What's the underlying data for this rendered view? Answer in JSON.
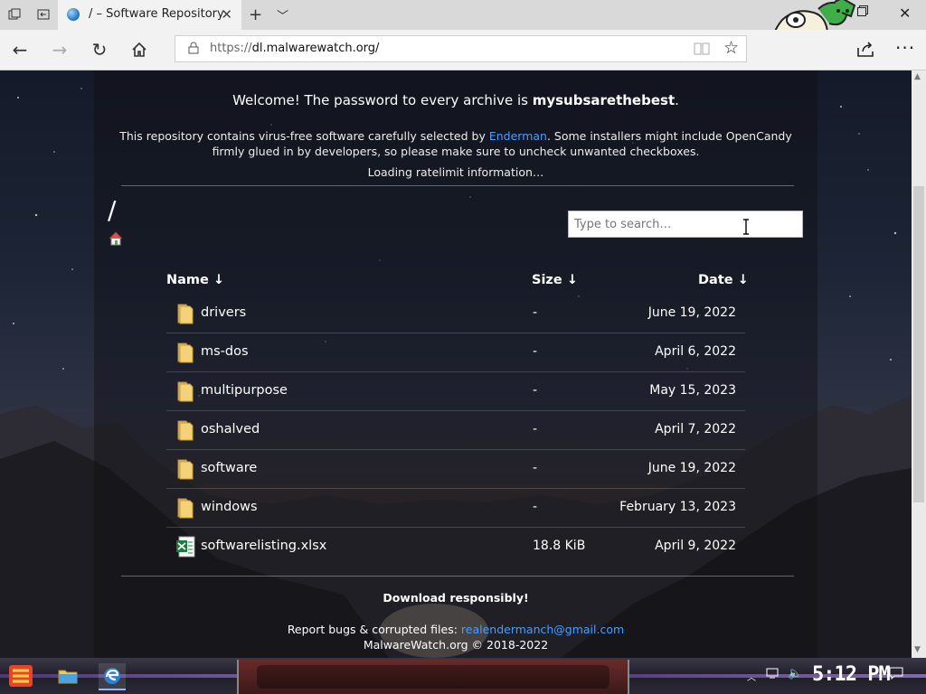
{
  "browser": {
    "tab_title": "/ – Software Repository",
    "url_protocol": "https://",
    "url_host": "dl.malwarewatch.org",
    "url_path": "/"
  },
  "page": {
    "welcome_text": "Welcome! The password to every archive is ",
    "password": "mysubsarethebest",
    "welcome_end": ".",
    "desc_part1": "This repository contains virus-free software carefully selected by ",
    "desc_link": "Enderman",
    "desc_part2": ". Some installers might include OpenCandy firmly glued in by developers, so please make sure to uncheck unwanted checkboxes.",
    "ratelimit": "Loading ratelimit information…",
    "path": "/",
    "search_placeholder": "Type to search…",
    "columns": {
      "name": "Name ↓",
      "size": "Size ↓",
      "date": "Date ↓"
    },
    "files": [
      {
        "name": "drivers",
        "size": "-",
        "date": "June 19, 2022",
        "type": "folder"
      },
      {
        "name": "ms-dos",
        "size": "-",
        "date": "April 6, 2022",
        "type": "folder"
      },
      {
        "name": "multipurpose",
        "size": "-",
        "date": "May 15, 2023",
        "type": "folder"
      },
      {
        "name": "oshalved",
        "size": "-",
        "date": "April 7, 2022",
        "type": "folder"
      },
      {
        "name": "software",
        "size": "-",
        "date": "June 19, 2022",
        "type": "folder"
      },
      {
        "name": "windows",
        "size": "-",
        "date": "February 13, 2023",
        "type": "folder"
      },
      {
        "name": "softwarelisting.xlsx",
        "size": "18.8 KiB",
        "date": "April 9, 2022",
        "type": "excel"
      }
    ],
    "footer_bold": "Download responsibly!",
    "footer_report": "Report bugs & corrupted files: ",
    "footer_email": "realendermanch@gmail.com",
    "footer_copyright": "MalwareWatch.org © 2018-2022"
  },
  "taskbar": {
    "clock": "5:12 PM"
  },
  "colors": {
    "link": "#4a9cff",
    "folder": "#e8c66a",
    "excel": "#1f7a3f"
  }
}
